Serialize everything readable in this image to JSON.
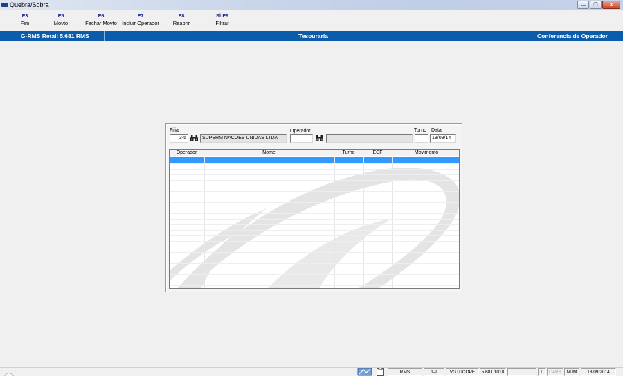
{
  "window": {
    "title": "Quebra/Sobra"
  },
  "toolbar": {
    "items": [
      {
        "key": "F3",
        "label": "Fim"
      },
      {
        "key": "F5",
        "label": "Movto"
      },
      {
        "key": "F6",
        "label": "Fechar Movto"
      },
      {
        "key": "F7",
        "label": "Incluir Operador"
      },
      {
        "key": "F8",
        "label": "Reabrir"
      },
      {
        "key": "ShF9",
        "label": "Filtrar"
      }
    ]
  },
  "header": {
    "left": "G-RMS Retail 5.681 RMS",
    "center": "Tesouraria",
    "right": "Conferencia de Operador"
  },
  "form": {
    "filial_label": "Filial",
    "filial_value": "3-5",
    "filial_name": "SUPERM NACOES UNIDAS LTDA",
    "operador_label": "Operador",
    "operador_value": "",
    "operador_name": "",
    "turno_label": "Turno",
    "turno_value": "",
    "data_label": "Data",
    "data_value": "18/09/14"
  },
  "grid": {
    "columns": [
      "Operador",
      "Nome",
      "Turno",
      "ECF",
      "Movimento"
    ]
  },
  "statusbar": {
    "items": [
      "RMS",
      "1-9",
      "VGTUCOPE",
      "5.681.1018",
      "",
      "L",
      "CAPS",
      "NUM",
      "18/09/2014"
    ]
  },
  "colors": {
    "header_blue": "#0c5cac",
    "fkey_blue": "#1a2a8c",
    "selection": "#3399ff"
  }
}
